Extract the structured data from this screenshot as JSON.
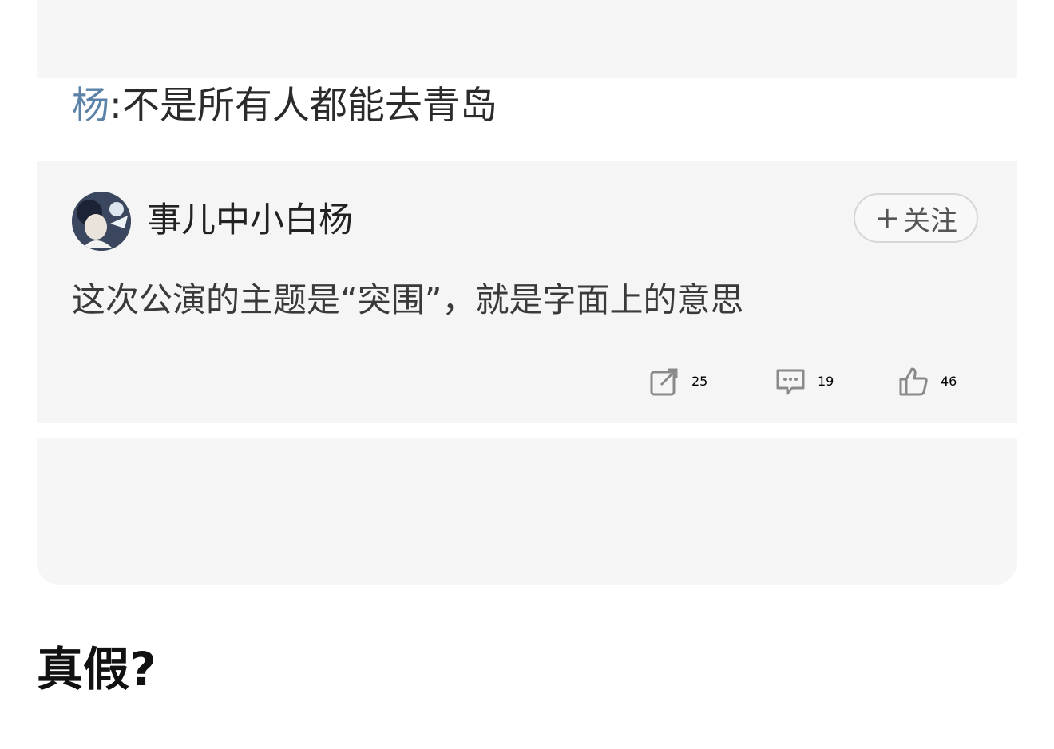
{
  "quote": {
    "author": "杨",
    "separator": ":",
    "text": "不是所有人都能去青岛"
  },
  "comment": {
    "username": "事儿中小白杨",
    "follow_plus": "+",
    "follow_label": "关注",
    "text": "这次公演的主题是“突围”，就是字面上的意思",
    "reposts": "25",
    "comments": "19",
    "likes": "46"
  },
  "question": "真假?",
  "icons": {
    "repost": "repost-icon",
    "comment": "comment-icon",
    "like": "thumbs-up-icon"
  },
  "colors": {
    "author_link": "#5b82a8",
    "action_gray": "#888888"
  }
}
